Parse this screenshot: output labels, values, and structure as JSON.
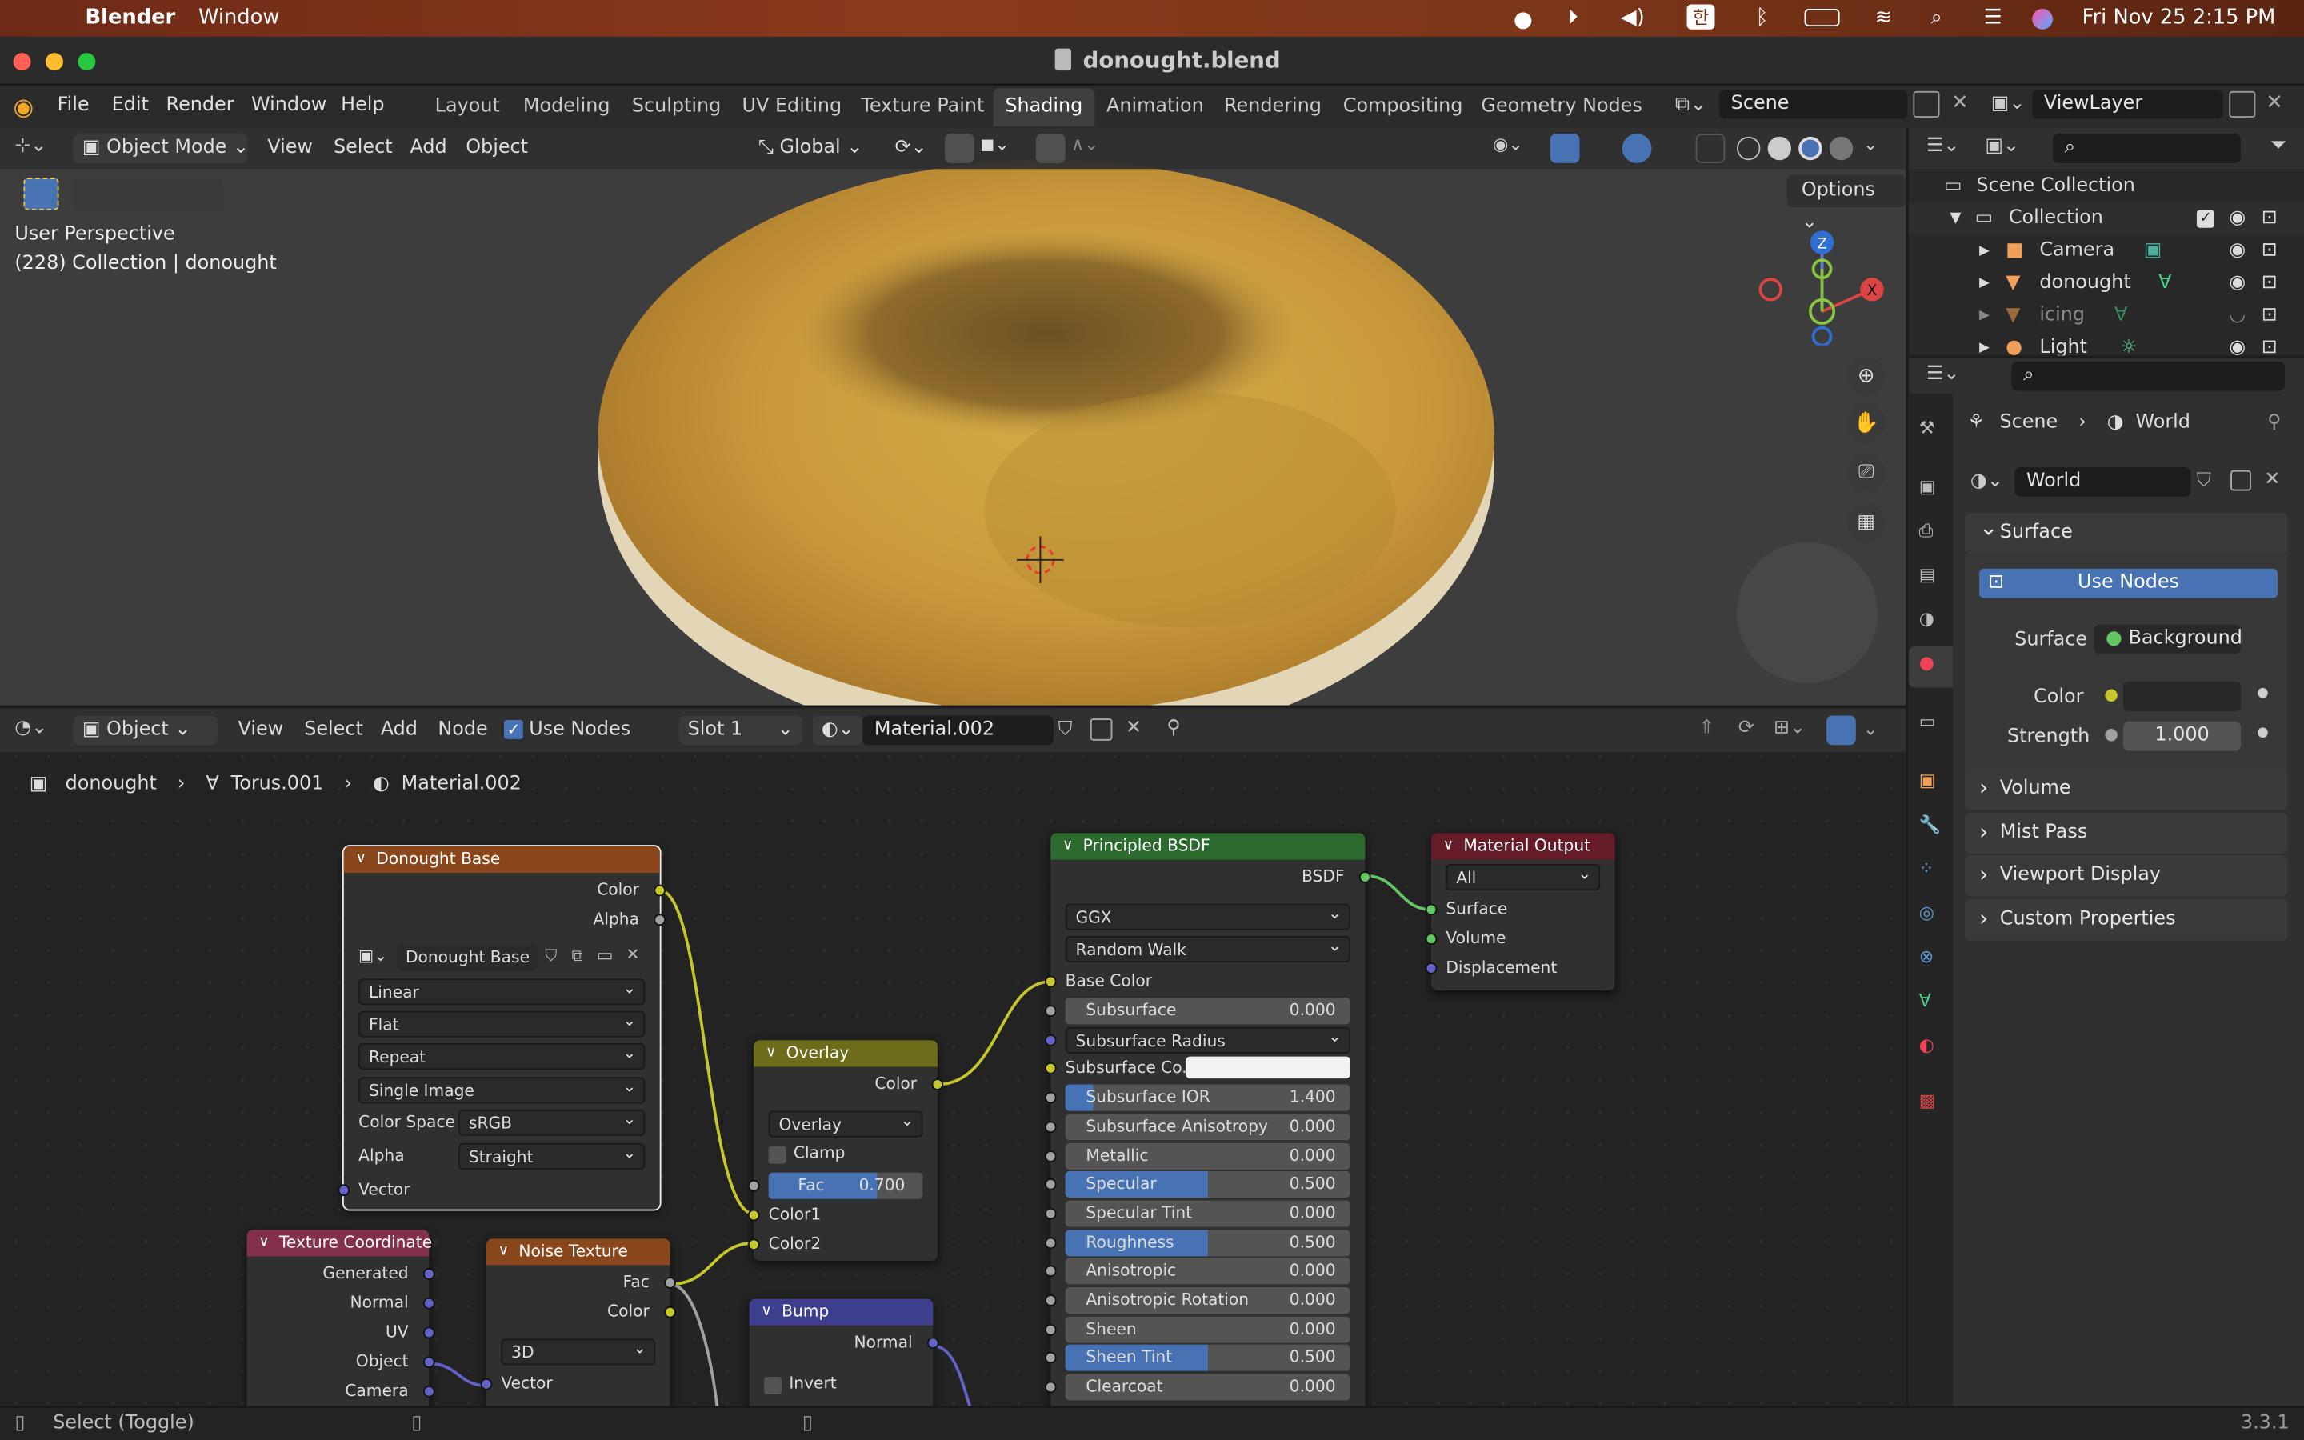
{
  "menubar": {
    "app": "Blender",
    "window": "Window",
    "datetime": "Fri Nov 25  2:15 PM",
    "input_method": "한"
  },
  "titlebar": {
    "title": "donought.blend"
  },
  "topbar": {
    "menus": [
      "File",
      "Edit",
      "Render",
      "Window",
      "Help"
    ],
    "workspaces": [
      "Layout",
      "Modeling",
      "Sculpting",
      "UV Editing",
      "Texture Paint",
      "Shading",
      "Animation",
      "Rendering",
      "Compositing",
      "Geometry Nodes"
    ],
    "active_workspace": "Shading",
    "scene": "Scene",
    "view_layer": "ViewLayer"
  },
  "viewport": {
    "mode": "Object Mode",
    "menus": [
      "View",
      "Select",
      "Add",
      "Object"
    ],
    "transform_orientation": "Global",
    "options": "Options",
    "overlay_line1": "User Perspective",
    "overlay_line2": "(228) Collection | donought",
    "gizmo_z": "Z",
    "gizmo_x": "X"
  },
  "node_editor": {
    "type": "Object",
    "menus": [
      "View",
      "Select",
      "Add",
      "Node"
    ],
    "use_nodes": "Use Nodes",
    "slot": "Slot 1",
    "material": "Material.002",
    "breadcrumb": [
      "donought",
      "Torus.001",
      "Material.002"
    ]
  },
  "nodes": {
    "image": {
      "title": "Donought Base",
      "out_color": "Color",
      "out_alpha": "Alpha",
      "image_name": "Donought Base",
      "interpolation": "Linear",
      "projection": "Flat",
      "extension": "Repeat",
      "source": "Single Image",
      "colorspace_label": "Color Space",
      "colorspace": "sRGB",
      "alpha_label": "Alpha",
      "alpha": "Straight",
      "vector": "Vector"
    },
    "overlay": {
      "title": "Overlay",
      "out_color": "Color",
      "blend": "Overlay",
      "clamp": "Clamp",
      "fac_label": "Fac",
      "fac": "0.700",
      "fac_value": 0.7,
      "color1": "Color1",
      "color2": "Color2"
    },
    "principled": {
      "title": "Principled BSDF",
      "out": "BSDF",
      "distribution": "GGX",
      "sss_method": "Random Walk",
      "base_color": "Base Color",
      "fields": [
        {
          "label": "Subsurface",
          "value": "0.000",
          "fill": 0
        },
        {
          "label": "Subsurface Radius",
          "type": "dropdown"
        },
        {
          "label": "Subsurface Co...",
          "type": "color"
        },
        {
          "label": "Subsurface IOR",
          "value": "1.400",
          "fill": 0.1
        },
        {
          "label": "Subsurface Anisotropy",
          "value": "0.000",
          "fill": 0
        },
        {
          "label": "Metallic",
          "value": "0.000",
          "fill": 0
        },
        {
          "label": "Specular",
          "value": "0.500",
          "fill": 0.5
        },
        {
          "label": "Specular Tint",
          "value": "0.000",
          "fill": 0
        },
        {
          "label": "Roughness",
          "value": "0.500",
          "fill": 0.5
        },
        {
          "label": "Anisotropic",
          "value": "0.000",
          "fill": 0
        },
        {
          "label": "Anisotropic Rotation",
          "value": "0.000",
          "fill": 0
        },
        {
          "label": "Sheen",
          "value": "0.000",
          "fill": 0
        },
        {
          "label": "Sheen Tint",
          "value": "0.500",
          "fill": 0.5
        },
        {
          "label": "Clearcoat",
          "value": "0.000",
          "fill": 0
        }
      ]
    },
    "output": {
      "title": "Material Output",
      "target": "All",
      "surface": "Surface",
      "volume": "Volume",
      "displacement": "Displacement"
    },
    "texcoord": {
      "title": "Texture Coordinate",
      "outputs": [
        "Generated",
        "Normal",
        "UV",
        "Object",
        "Camera"
      ]
    },
    "noise": {
      "title": "Noise Texture",
      "fac": "Fac",
      "color": "Color",
      "dimensions": "3D",
      "vector": "Vector"
    },
    "bump": {
      "title": "Bump",
      "normal": "Normal",
      "invert": "Invert"
    }
  },
  "outliner": {
    "root": "Scene Collection",
    "collection": "Collection",
    "items": [
      {
        "name": "Camera"
      },
      {
        "name": "donought"
      },
      {
        "name": "icing"
      },
      {
        "name": "Light"
      }
    ]
  },
  "properties": {
    "breadcrumb_scene": "Scene",
    "breadcrumb_world": "World",
    "world_name": "World",
    "surface_panel": "Surface",
    "use_nodes": "Use Nodes",
    "surface_label": "Surface",
    "surface_value": "Background",
    "color_label": "Color",
    "strength_label": "Strength",
    "strength": "1.000",
    "panels": [
      "Volume",
      "Mist Pass",
      "Viewport Display",
      "Custom Properties"
    ]
  },
  "statusbar": {
    "hint": "Select (Toggle)",
    "version": "3.3.1"
  },
  "colors": {
    "accent": "#4772b3",
    "node_input": "#83314a",
    "node_texture": "#88461a",
    "node_color": "#6c6c1b",
    "node_shader": "#2b6b2e",
    "node_output": "#651c28",
    "node_vector": "#3e3e8e",
    "socket_color": "#c7c729",
    "socket_shader": "#63c763",
    "socket_float": "#a1a1a1",
    "socket_vector": "#6363c7"
  }
}
